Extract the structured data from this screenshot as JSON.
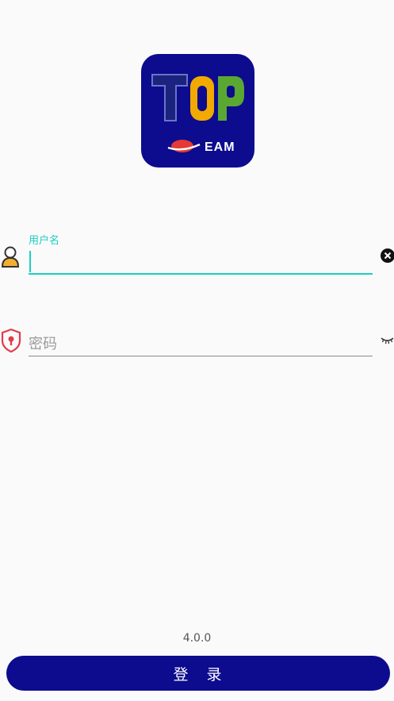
{
  "logo": {
    "wordmark": "TOP",
    "sub_text": "EAM",
    "colors": {
      "background": "#0d0b8e",
      "t": "#1a237e",
      "o": "#f2a900",
      "p": "#5aa832",
      "swoosh": "#e53935"
    }
  },
  "username": {
    "label": "用户名",
    "value": "",
    "left_icon": "user-icon",
    "right_icon": "clear-icon"
  },
  "password": {
    "placeholder": "密码",
    "value": "",
    "left_icon": "lock-shield-icon",
    "right_icon": "eye-closed-icon"
  },
  "version": "4.0.0",
  "login_button": {
    "label": "登　录"
  },
  "colors": {
    "accent": "#1ccfc0",
    "primary": "#0d0b8e",
    "background": "#fafafa"
  }
}
